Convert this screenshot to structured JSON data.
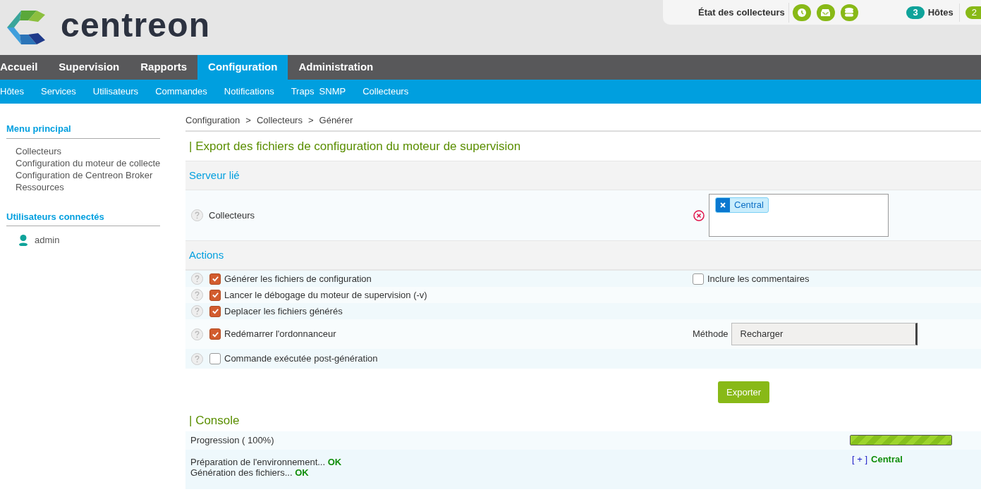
{
  "header": {
    "logo_text": "centreon",
    "poller_status": "État des collecteurs",
    "hosts": {
      "count": "3",
      "label": "Hôtes"
    },
    "services": {
      "count": "2"
    }
  },
  "top_menu": [
    {
      "label": "Accueil",
      "selected": false
    },
    {
      "label": "Supervision",
      "selected": false
    },
    {
      "label": "Rapports",
      "selected": false
    },
    {
      "label": "Configuration",
      "selected": true
    },
    {
      "label": "Administration",
      "selected": false
    }
  ],
  "sub_menu": [
    "Hôtes",
    "Services",
    "Utilisateurs",
    "Commandes",
    "Notifications",
    "Traps  SNMP",
    "Collecteurs"
  ],
  "sidebar": {
    "menu_title": "Menu principal",
    "menu_items": [
      "Collecteurs",
      "Configuration du moteur de collecte",
      "Configuration de Centreon Broker",
      "Ressources"
    ],
    "users_title": "Utilisateurs connectés",
    "users": [
      "admin"
    ]
  },
  "breadcrumb": [
    {
      "label": "Configuration"
    },
    {
      "separator": ">",
      "label": "Collecteurs"
    },
    {
      "separator": ">",
      "label": "Générer"
    }
  ],
  "page_title": "| Export des fichiers de configuration du moteur de supervision",
  "server_section": {
    "title": "Serveur lié",
    "field_label": "Collecteurs",
    "tags": [
      "Central"
    ]
  },
  "actions": {
    "title": "Actions",
    "rows": [
      {
        "label": "Générer les fichiers de configuration",
        "checked": true,
        "extra": {
          "kind": "checkbox",
          "label": "Inclure les commentaires",
          "checked": false
        }
      },
      {
        "label": "Lancer le débogage du moteur de supervision (-v)",
        "checked": true
      },
      {
        "label": "Deplacer les fichiers générés",
        "checked": true
      },
      {
        "label": "Redémarrer l'ordonnanceur",
        "checked": true,
        "extra": {
          "kind": "select",
          "label": "Méthode",
          "value": "Recharger"
        }
      },
      {
        "label": "Commande exécutée post-génération",
        "checked": false
      }
    ]
  },
  "export_button": "Exporter",
  "console": {
    "title": "| Console",
    "progress_label": "Progression ( 100%)",
    "level": 1,
    "log": [
      "Préparation de l'environnement... **OK**",
      "Génération des fichiers... **OK**"
    ],
    "toggle": "[ + ]",
    "poller": "Central"
  }
}
